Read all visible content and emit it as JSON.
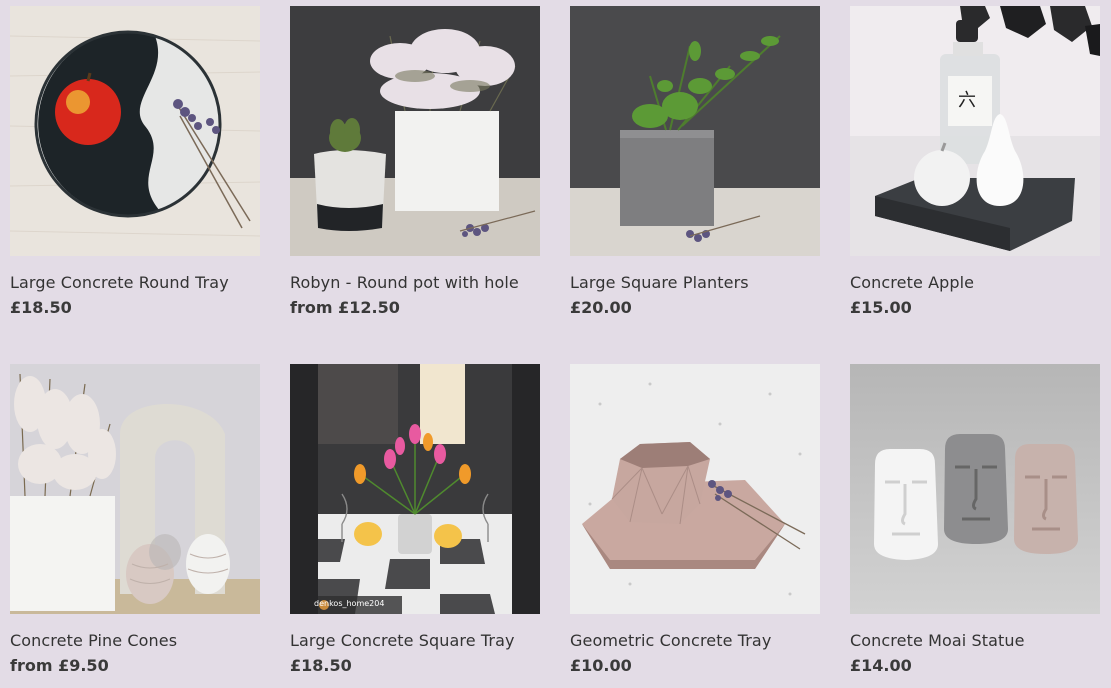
{
  "products": [
    {
      "title": "Large Concrete Round Tray",
      "price": "£18.50",
      "image_icon": "round-tray-with-apple-image"
    },
    {
      "title": "Robyn - Round pot with hole",
      "price": "from £12.50",
      "image_icon": "round-pot-with-succulent-image"
    },
    {
      "title": "Large Square Planters",
      "price": "£20.00",
      "image_icon": "square-planter-image"
    },
    {
      "title": "Concrete Apple",
      "price": "£15.00",
      "image_icon": "concrete-apple-and-pear-image"
    },
    {
      "title": "Concrete Pine Cones",
      "price": "from £9.50",
      "image_icon": "concrete-pine-cones-image"
    },
    {
      "title": "Large Concrete Square Tray",
      "price": "£18.50",
      "image_icon": "square-tray-table-setting-image",
      "photo_handle": "denkos_home204"
    },
    {
      "title": "Geometric Concrete Tray",
      "price": "£10.00",
      "image_icon": "geometric-tray-image"
    },
    {
      "title": "Concrete Moai Statue",
      "price": "£14.00",
      "image_icon": "moai-statues-image"
    }
  ],
  "colors": {
    "background": "#e3dce6",
    "title_text": "#333333",
    "price_text": "#3a3a3a"
  }
}
